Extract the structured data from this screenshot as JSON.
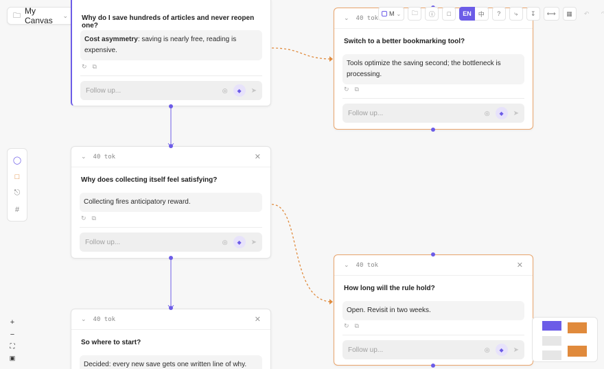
{
  "canvas": {
    "title": "My Canvas"
  },
  "toolbar": {
    "model_label": "M",
    "lang_active": "EN",
    "lang_alt": "中",
    "icons": [
      "folder-icon",
      "info-icon",
      "file-icon",
      "help-icon",
      "fork-icon",
      "download-icon",
      "share-icon",
      "grid-icon",
      "undo-icon",
      "redo-icon"
    ]
  },
  "rail": {
    "icons": [
      "question-icon",
      "note-icon",
      "attachment-icon",
      "frame-icon"
    ]
  },
  "cards": [
    {
      "question": "Why do I save hundreds of articles and never reopen one?",
      "answer_bold": "Cost asymmetry",
      "answer_rest": ": saving is nearly free, reading is expensive.",
      "follow_placeholder": "Follow up..."
    },
    {
      "tokens": "40 tok",
      "question": "Why does collecting itself feel satisfying?",
      "answer": "Collecting fires anticipatory reward.",
      "follow_placeholder": "Follow up..."
    },
    {
      "tokens": "40 tok",
      "question": "So where to start?",
      "answer": "Decided: every new save gets one written line of why."
    },
    {
      "tokens": "40 tok",
      "question": "Switch to a better bookmarking tool?",
      "answer": "Tools optimize the saving second; the bottleneck is processing.",
      "follow_placeholder": "Follow up..."
    },
    {
      "tokens": "40 tok",
      "question": "How long will the rule hold?",
      "answer": "Open. Revisit in two weeks.",
      "follow_placeholder": "Follow up..."
    }
  ],
  "colors": {
    "accent": "#6c5ce7",
    "branch": "#e08a3c"
  }
}
